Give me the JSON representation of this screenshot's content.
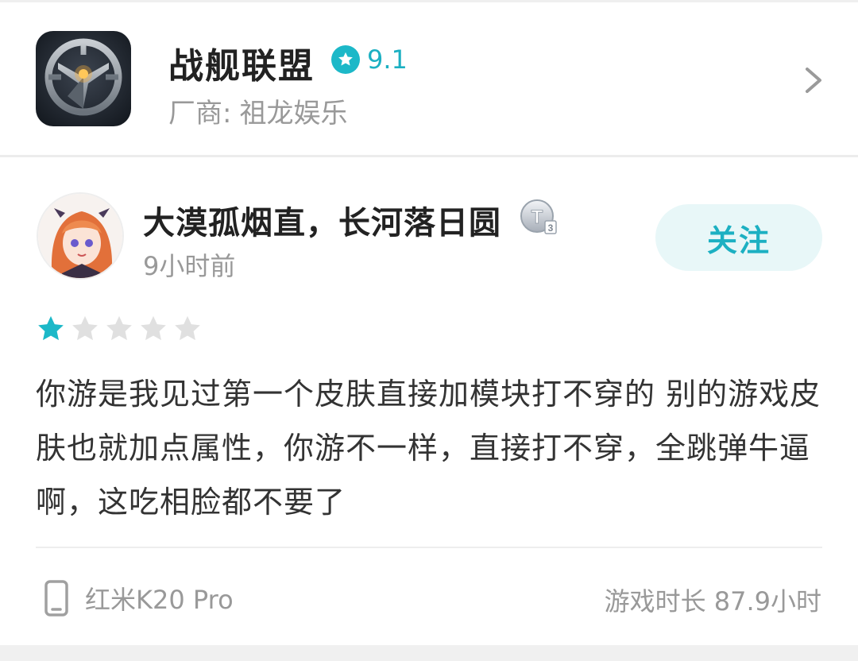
{
  "game": {
    "name": "战舰联盟",
    "score": "9.1",
    "vendor_label": "厂商:",
    "vendor_name": "祖龙娱乐",
    "icon": "game-logo-icon"
  },
  "review": {
    "user_name": "大漠孤烟直，长河落日圆",
    "level_badge": "T3",
    "time_ago": "9小时前",
    "follow_label": "关注",
    "rating": 1,
    "rating_max": 5,
    "text": "你游是我见过第一个皮肤直接加模块打不穿的 别的游戏皮肤也就加点属性，你游不一样，直接打不穿，全跳弹牛逼啊，这吃相脸都不要了",
    "device": "红米K20 Pro",
    "playtime": "游戏时长 87.9小时"
  },
  "colors": {
    "accent": "#1cb0c2",
    "star_filled": "#1cb8c8",
    "star_empty": "#e0e0e0"
  }
}
